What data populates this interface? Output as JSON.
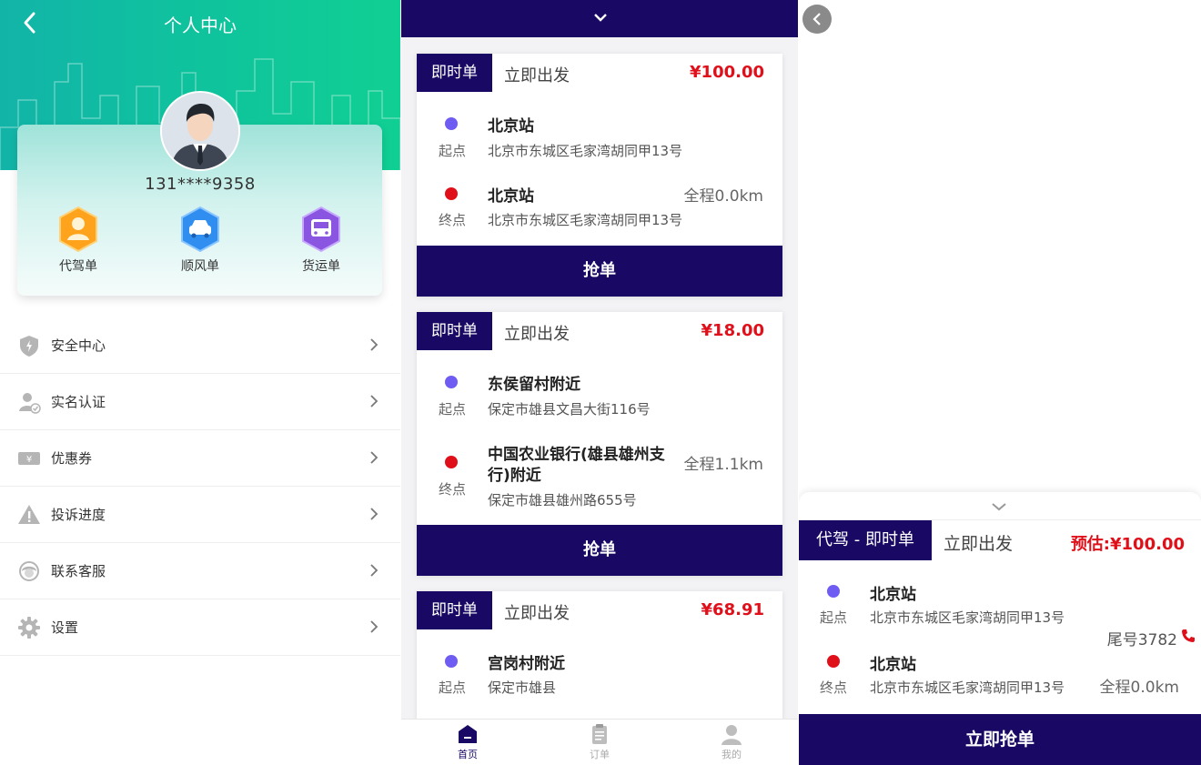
{
  "profile": {
    "title": "个人中心",
    "phone": "131****9358",
    "orders": [
      {
        "label": "代驾单",
        "color": "#ff9f1a"
      },
      {
        "label": "顺风单",
        "color": "#2f8ef0"
      },
      {
        "label": "货运单",
        "color": "#8a55e0"
      }
    ],
    "menu": [
      {
        "label": "安全中心",
        "icon": "shield-icon"
      },
      {
        "label": "实名认证",
        "icon": "user-verify-icon"
      },
      {
        "label": "优惠券",
        "icon": "coupon-icon"
      },
      {
        "label": "投诉进度",
        "icon": "warning-icon"
      },
      {
        "label": "联系客服",
        "icon": "customer-service-icon"
      },
      {
        "label": "设置",
        "icon": "gear-icon"
      }
    ]
  },
  "orderList": {
    "cards": [
      {
        "tag": "即时单",
        "depart": "立即出发",
        "price": "¥100.00",
        "start": {
          "label": "起点",
          "name": "北京站",
          "address": "北京市东城区毛家湾胡同甲13号"
        },
        "end": {
          "label": "终点",
          "name": "北京站",
          "address": "北京市东城区毛家湾胡同甲13号"
        },
        "distance": "全程0.0km",
        "button": "抢单"
      },
      {
        "tag": "即时单",
        "depart": "立即出发",
        "price": "¥18.00",
        "start": {
          "label": "起点",
          "name": "东侯留村附近",
          "address": "保定市雄县文昌大街116号"
        },
        "end": {
          "label": "终点",
          "name_line1": "中国农业银行(雄县雄州支",
          "name_line2": "行)附近",
          "address": "保定市雄县雄州路655号"
        },
        "distance": "全程1.1km",
        "button": "抢单"
      },
      {
        "tag": "即时单",
        "depart": "立即出发",
        "price": "¥68.91",
        "start": {
          "label": "起点",
          "name": "宫岗村附近",
          "address": "保定市雄县"
        }
      }
    ],
    "tabs": [
      {
        "label": "首页",
        "icon": "home-icon",
        "active": true
      },
      {
        "label": "订单",
        "icon": "clipboard-icon",
        "active": false
      },
      {
        "label": "我的",
        "icon": "person-icon",
        "active": false
      }
    ]
  },
  "detail": {
    "tag": "代驾 - 即时单",
    "depart": "立即出发",
    "price": "预估:¥100.00",
    "start": {
      "label": "起点",
      "name": "北京站",
      "address": "北京市东城区毛家湾胡同甲13号"
    },
    "end": {
      "label": "终点",
      "name": "北京站",
      "address": "北京市东城区毛家湾胡同甲13号"
    },
    "tail": "尾号3782",
    "distance": "全程0.0km",
    "button": "立即抢单"
  },
  "colors": {
    "navy": "#1a0964",
    "teal": "#10c49d",
    "red": "#e0101a",
    "startDot": "#6f5cf2"
  }
}
